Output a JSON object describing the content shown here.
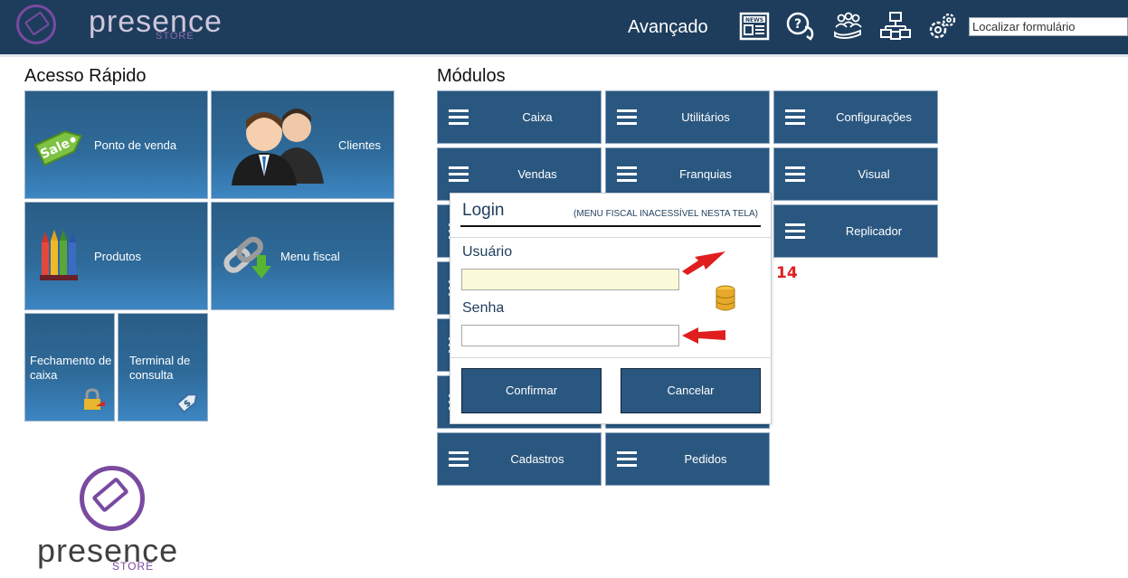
{
  "brand": {
    "name": "presence",
    "sub": "STORE"
  },
  "header": {
    "advanced_label": "Avançado",
    "icons": [
      "news-icon",
      "help-icon",
      "users-icon",
      "network-icon",
      "settings-icon"
    ],
    "search_placeholder": "Localizar formulário"
  },
  "quick_access": {
    "title": "Acesso Rápido",
    "tiles": [
      {
        "label": "Ponto de venda",
        "icon": "sale-tag-icon"
      },
      {
        "label": "Clientes",
        "icon": "people-icon"
      },
      {
        "label": "Produtos",
        "icon": "crayons-icon"
      },
      {
        "label": "Menu fiscal",
        "icon": "chain-download-icon"
      },
      {
        "label": "Fechamento de caixa",
        "icon": "lock-key-icon"
      },
      {
        "label": "Terminal de consulta",
        "icon": "price-tag-icon"
      }
    ]
  },
  "modules": {
    "title": "Módulos",
    "items": [
      "Caixa",
      "Utilitários",
      "Configurações",
      "Vendas",
      "Franquias",
      "Visual",
      "Replicador",
      "Cadastros",
      "Pedidos"
    ]
  },
  "login": {
    "title": "Login",
    "note": "(MENU FISCAL INACESSÍVEL NESTA TELA)",
    "user_label": "Usuário",
    "password_label": "Senha",
    "confirm": "Confirmar",
    "cancel": "Cancelar"
  },
  "badge": "14",
  "colors": {
    "header": "#1e3d5c",
    "tile": "#2a5780",
    "brand": "#7a4aa1",
    "arrow": "#e01e1e"
  }
}
